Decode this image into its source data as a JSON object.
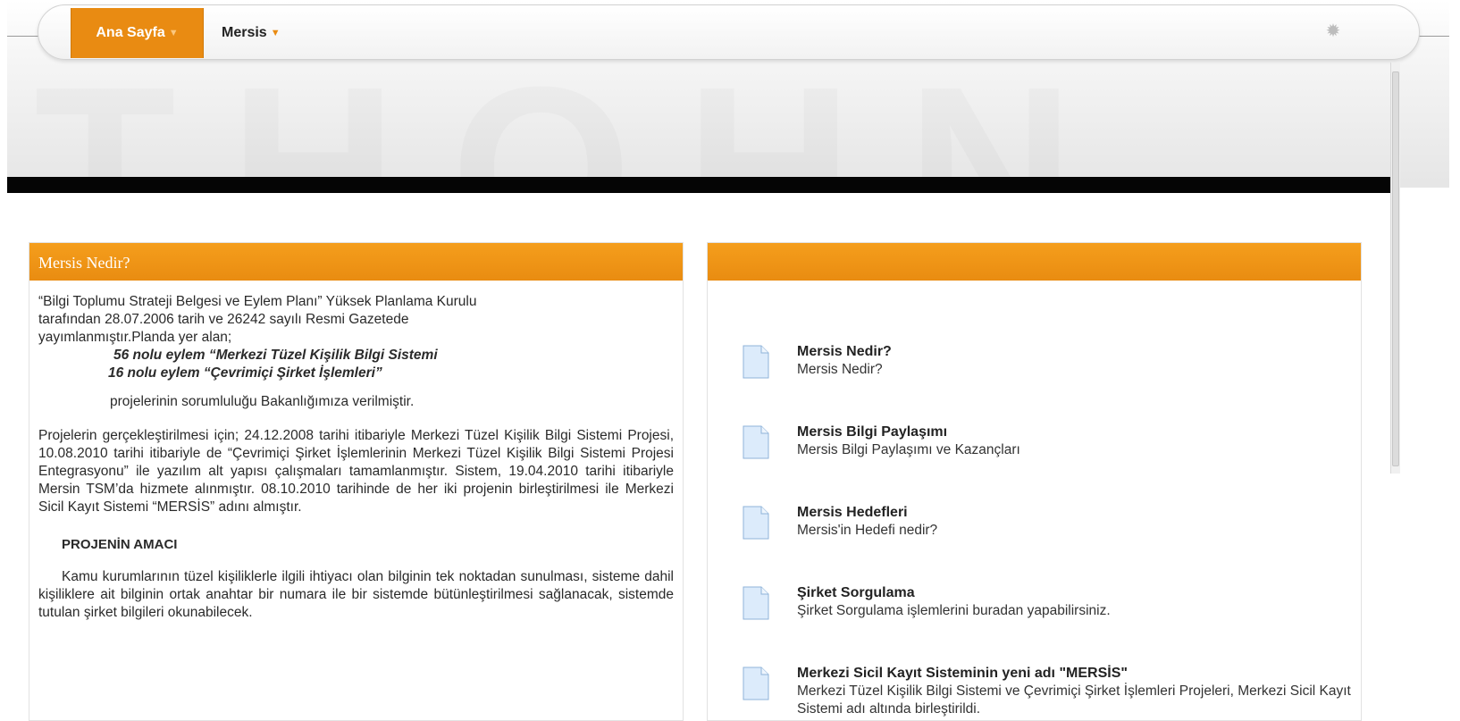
{
  "nav": {
    "home_label": "Ana Sayfa",
    "mersis_label": "Mersis",
    "caret_icon": "caret-down-icon",
    "settings_icon": "gear-icon"
  },
  "colors": {
    "accent": "#e98b12",
    "header_bar": "#050505"
  },
  "left_panel": {
    "title": "Mersis Nedir?",
    "p1": "“Bilgi Toplumu Strateji Belgesi ve Eylem Planı” Yüksek Planlama Kurulu",
    "p1b": "tarafından 28.07.2006 tarih ve 26242 sayılı  Resmi Gazetede",
    "p1c": "yayımlanmıştır.Planda yer alan;",
    "item1": "56 nolu eylem “Merkezi Tüzel Kişilik Bilgi Sistemi",
    "item2": "16 nolu eylem “Çevrimiçi Şirket İşlemleri”",
    "p2": "projelerinin sorumluluğu Bakanlığımıza verilmiştir.",
    "p3": "Projelerin gerçekleştirilmesi için; 24.12.2008 tarihi itibariyle Merkezi Tüzel Kişilik Bilgi Sistemi Projesi, 10.08.2010 tarihi itibariyle de “Çevrimiçi Şirket İşlemlerinin Merkezi Tüzel Kişilik Bilgi Sistemi Projesi Entegrasyonu” ile yazılım alt yapısı çalışmaları tamamlanmıştır. Sistem, 19.04.2010 tarihi itibariyle Mersin TSM’da hizmete alınmıştır. 08.10.2010 tarihinde de her iki projenin birleştirilmesi ile Merkezi Sicil Kayıt Sistemi “MERSİS” adını almıştır.",
    "subhead": "PROJENİN AMACI",
    "p4": "Kamu kurumlarının tüzel kişiliklerle ilgili ihtiyacı olan bilginin tek noktadan sunulması, sisteme dahil kişiliklere ait bilginin ortak anahtar bir numara ile bir sistemde bütünleştirilmesi sağlanacak, sistemde tutulan şirket bilgileri okunabilecek."
  },
  "right_panel": {
    "title": "",
    "items": [
      {
        "title": "Mersis Nedir?",
        "desc": "Mersis Nedir?",
        "icon": "document-icon"
      },
      {
        "title": "Mersis Bilgi Paylaşımı",
        "desc": "Mersis Bilgi Paylaşımı ve Kazançları",
        "icon": "document-icon"
      },
      {
        "title": "Mersis Hedefleri",
        "desc": "Mersis'in Hedefi nedir?",
        "icon": "document-icon"
      },
      {
        "title": "Şirket Sorgulama",
        "desc": "Şirket Sorgulama işlemlerini buradan yapabilirsiniz.",
        "icon": "document-icon"
      },
      {
        "title": "Merkezi Sicil Kayıt Sisteminin yeni adı \"MERSİS\"",
        "desc": "Merkezi Tüzel Kişilik Bilgi Sistemi ve Çevrimiçi Şirket İşlemleri Projeleri, Merkezi Sicil Kayıt Sistemi adı altında birleştirildi.",
        "icon": "document-icon"
      }
    ]
  }
}
